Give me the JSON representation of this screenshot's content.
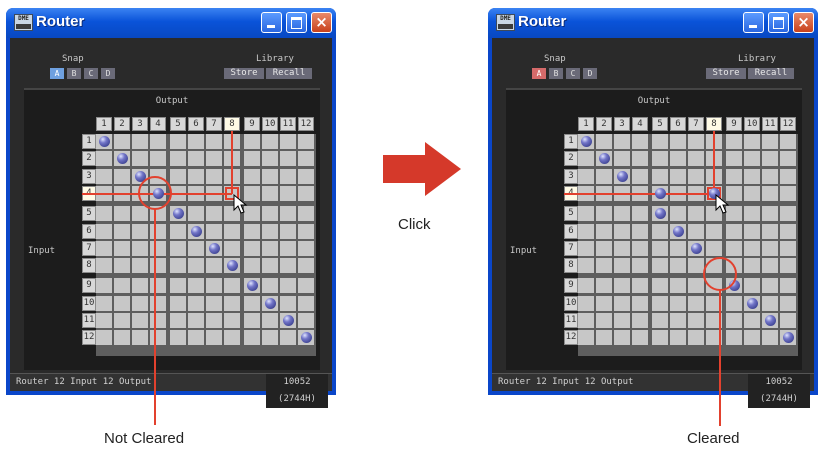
{
  "left_window": {
    "title": "Router",
    "app_icon_text": "DME",
    "snap_label": "Snap",
    "snap_buttons": [
      "A",
      "B",
      "C",
      "D"
    ],
    "library_label": "Library",
    "library_buttons": [
      "Store",
      "Recall"
    ],
    "output_label": "Output",
    "input_label": "Input",
    "status_info": "Router   12 Input  12 Output",
    "status_memory": "10052 (2744H)",
    "column_headers": [
      "1",
      "2",
      "3",
      "4",
      "5",
      "6",
      "7",
      "8",
      "9",
      "10",
      "11",
      "12"
    ],
    "row_headers": [
      "1",
      "2",
      "3",
      "4",
      "5",
      "6",
      "7",
      "8",
      "9",
      "10",
      "11",
      "12"
    ],
    "connections": [
      [
        1,
        1
      ],
      [
        2,
        2
      ],
      [
        3,
        3
      ],
      [
        4,
        4
      ],
      [
        5,
        5
      ],
      [
        6,
        6
      ],
      [
        7,
        7
      ],
      [
        8,
        8
      ],
      [
        9,
        9
      ],
      [
        10,
        10
      ],
      [
        11,
        11
      ],
      [
        12,
        12
      ]
    ],
    "cursor_at": [
      4,
      8
    ]
  },
  "right_window": {
    "title": "Router",
    "app_icon_text": "DME",
    "snap_label": "Snap",
    "snap_buttons": [
      "A",
      "B",
      "C",
      "D"
    ],
    "library_label": "Library",
    "library_buttons": [
      "Store",
      "Recall"
    ],
    "output_label": "Output",
    "input_label": "Input",
    "status_info": "Router   12 Input  12 Output",
    "status_memory": "10052 (2744H)",
    "column_headers": [
      "1",
      "2",
      "3",
      "4",
      "5",
      "6",
      "7",
      "8",
      "9",
      "10",
      "11",
      "12"
    ],
    "row_headers": [
      "1",
      "2",
      "3",
      "4",
      "5",
      "6",
      "7",
      "8",
      "9",
      "10",
      "11",
      "12"
    ],
    "connections": [
      [
        1,
        1
      ],
      [
        2,
        2
      ],
      [
        3,
        3
      ],
      [
        4,
        5
      ],
      [
        5,
        5
      ],
      [
        6,
        6
      ],
      [
        7,
        7
      ],
      [
        4,
        8
      ],
      [
        9,
        9
      ],
      [
        10,
        10
      ],
      [
        11,
        11
      ],
      [
        12,
        12
      ]
    ],
    "cursor_at": [
      4,
      8
    ]
  },
  "middle": {
    "action_label": "Click"
  },
  "captions": {
    "left": "Not Cleared",
    "right": "Cleared"
  },
  "colors": {
    "accent_red": "#e2412e",
    "title_blue": "#0a53d9"
  }
}
